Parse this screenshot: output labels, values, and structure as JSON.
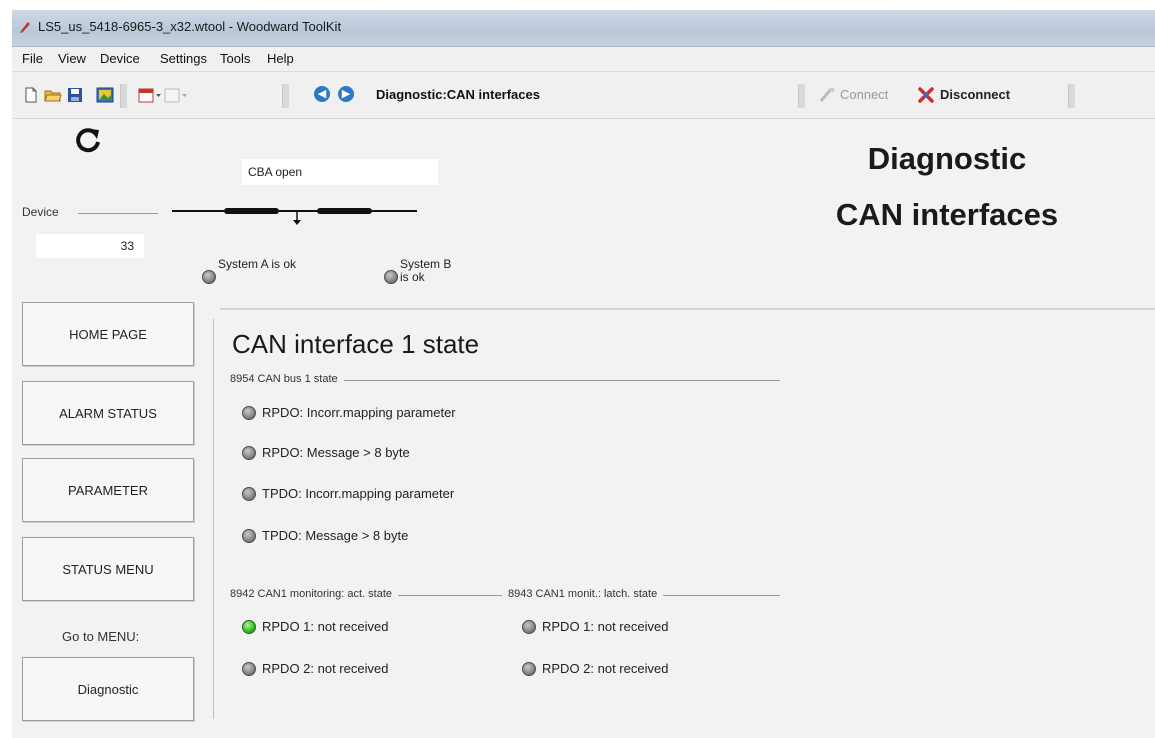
{
  "window": {
    "title": "LS5_us_5418-6965-3_x32.wtool - Woodward ToolKit"
  },
  "menu": [
    "File",
    "View",
    "Device",
    "Settings",
    "Tools",
    "Help"
  ],
  "toolbar": {
    "breadcrumb": "Diagnostic:CAN interfaces",
    "connect_label": "Connect",
    "disconnect_label": "Disconnect"
  },
  "header": {
    "cba_status": "CBA open",
    "device_label": "Device",
    "device_value": "33",
    "system_a_status": "System A is ok",
    "system_b_status": "System B is ok",
    "page_title_line1": "Diagnostic",
    "page_title_line2": "CAN interfaces"
  },
  "sidebar": {
    "buttons": [
      "HOME PAGE",
      "ALARM STATUS",
      "PARAMETER",
      "STATUS MENU"
    ],
    "goto_label": "Go to MENU:",
    "goto_button": "Diagnostic"
  },
  "main": {
    "section_title": "CAN interface 1 state",
    "bus_group_label": "8954 CAN bus 1 state",
    "bus_items": [
      {
        "label": "RPDO: Incorr.mapping parameter",
        "state": "off"
      },
      {
        "label": "RPDO: Message > 8 byte",
        "state": "off"
      },
      {
        "label": "TPDO: Incorr.mapping parameter",
        "state": "off"
      },
      {
        "label": "TPDO: Message > 8 byte",
        "state": "off"
      }
    ],
    "monitoring_group_label": "8942 CAN1 monitoring: act. state",
    "monitoring_items": [
      {
        "label": "RPDO 1: not received",
        "state": "on"
      },
      {
        "label": "RPDO 2: not received",
        "state": "off"
      }
    ],
    "latch_group_label": "8943 CAN1 monit.: latch. state",
    "latch_items": [
      {
        "label": "RPDO 1: not received",
        "state": "off"
      },
      {
        "label": "RPDO 2: not received",
        "state": "off"
      }
    ]
  },
  "colors": {
    "led_off": "#8a8a8a",
    "led_on": "#3dbb28",
    "nav_accent": "#2e79c7"
  },
  "icons": [
    "app-icon",
    "new-file-icon",
    "open-folder-icon",
    "save-icon",
    "image-icon",
    "calendar-icon",
    "page-icon",
    "back-icon",
    "forward-icon",
    "connect-icon",
    "disconnect-icon",
    "refresh-icon"
  ]
}
